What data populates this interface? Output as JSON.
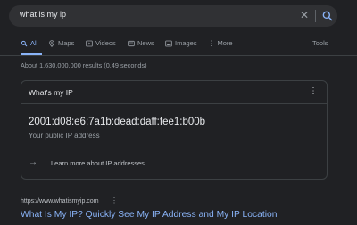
{
  "search": {
    "query": "what is my ip"
  },
  "tabs": [
    {
      "label": "All",
      "icon": "search-icon",
      "active": true
    },
    {
      "label": "Maps",
      "icon": "map-pin-icon"
    },
    {
      "label": "Videos",
      "icon": "play-icon"
    },
    {
      "label": "News",
      "icon": "news-icon"
    },
    {
      "label": "Images",
      "icon": "image-icon"
    },
    {
      "label": "More",
      "icon": "more-vertical-icon"
    }
  ],
  "tools_label": "Tools",
  "result_stats": "About 1,630,000,000 results (0.49 seconds)",
  "ip_card": {
    "title": "What's my IP",
    "ip": "2001:d08:e6:7a1b:dead:daff:fee1:b00b",
    "subtitle": "Your public IP address",
    "learn_more": "Learn more about IP addresses"
  },
  "first_result": {
    "url": "https://www.whatismyip.com",
    "title": "What Is My IP? Quickly See My IP Address and My IP Location"
  },
  "colors": {
    "background": "#202124",
    "accent": "#8ab4f8",
    "text": "#bdc1c6"
  }
}
